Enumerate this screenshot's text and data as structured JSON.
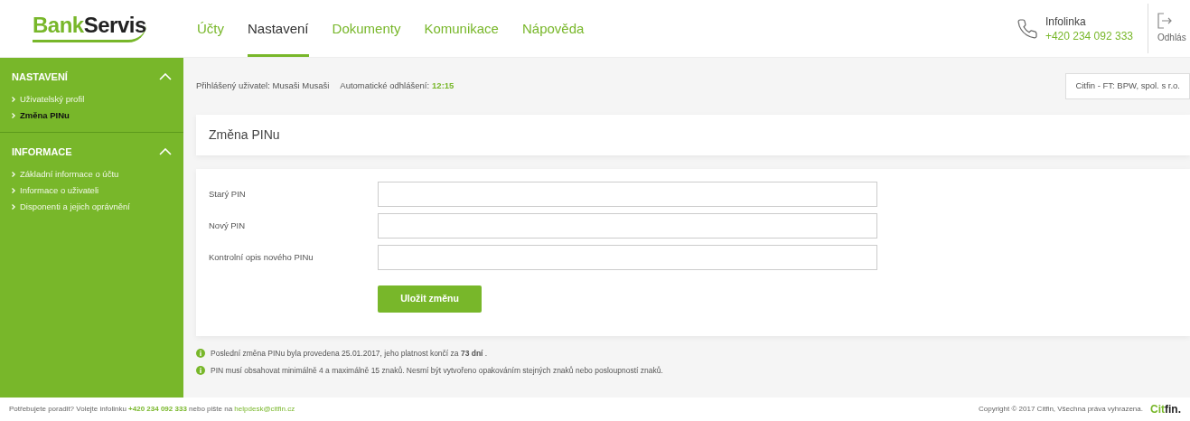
{
  "logo": {
    "part_1": "Bank",
    "part_2": "Servis"
  },
  "nav": [
    {
      "label": "Účty",
      "selected": false
    },
    {
      "label": "Nastavení",
      "selected": true
    },
    {
      "label": "Dokumenty",
      "selected": false
    },
    {
      "label": "Komunikace",
      "selected": false
    },
    {
      "label": "Nápověda",
      "selected": false
    }
  ],
  "infoline": {
    "label": "Infolinka",
    "phone": "+420 234 092 333"
  },
  "logout": {
    "label": "Odhlás"
  },
  "sidebar": {
    "sections": [
      {
        "title": "NASTAVENÍ",
        "expanded": true,
        "items": [
          {
            "label": "Uživatelský profil",
            "selected": false
          },
          {
            "label": "Změna PINu",
            "selected": true
          }
        ]
      },
      {
        "title": "INFORMACE",
        "expanded": true,
        "items": [
          {
            "label": "Základní informace o účtu",
            "selected": false
          },
          {
            "label": "Informace o uživateli",
            "selected": false
          },
          {
            "label": "Disponenti a jejich oprávnění",
            "selected": false
          }
        ]
      }
    ]
  },
  "session": {
    "user_label": "Přihlášený uživatel: Musaši Musaši",
    "logout_label": "Automatické odhlášení:",
    "logout_time": "12:15"
  },
  "company": "Citfin - FT: BPW, spol. s r.o.",
  "page_title": "Změna PINu",
  "form": {
    "fields": [
      {
        "label": "Starý PIN"
      },
      {
        "label": "Nový PIN"
      },
      {
        "label": "Kontrolní opis nového PINu"
      }
    ],
    "submit": "Uložit změnu"
  },
  "notes": [
    "Poslední změna PINu byla provedena 25.01.2017, jeho platnost končí za **73 dní** .",
    "PIN musí obsahovat minimálně 4 a maximálně 15 znaků. Nesmí být vytvořeno opakováním stejných znaků nebo posloupností znaků."
  ],
  "footer": {
    "text_1": "Potřebujete poradit? Volejte infolinku",
    "phone": "+420 234 092 333",
    "text_2": "nebo pište na",
    "email": "helpdesk@citfin.cz",
    "copyright": "Copyright © 2017 Citfin, Všechna práva vyhrazena.",
    "logo": {
      "part_1": "Cit",
      "part_2": "fin."
    }
  }
}
